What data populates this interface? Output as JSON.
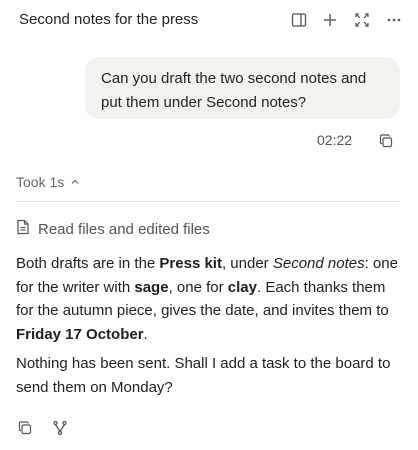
{
  "header": {
    "title": "Second notes for the press",
    "icons": [
      "sidebar-panel-icon",
      "plus-icon",
      "expand-icon",
      "more-icon"
    ]
  },
  "user_message": {
    "text": "Can you draft the two second notes and put them under Second notes?",
    "time": "02:22"
  },
  "response": {
    "took_label": "Took 1s",
    "activity_label": "Read files and edited files",
    "p1": {
      "t1": "Both drafts are in the ",
      "b1": "Press kit",
      "t2": ", under ",
      "i1": "Second notes",
      "t3": ": one for the writer with ",
      "b2": "sage",
      "t4": ", one for ",
      "b3": "clay",
      "t5": ". Each thanks them for the autumn piece, gives the date, and invites them to ",
      "b4": "Friday 17 October",
      "t6": "."
    },
    "p2": "Nothing has been sent. Shall I add a task to the board to send them on Monday?"
  }
}
